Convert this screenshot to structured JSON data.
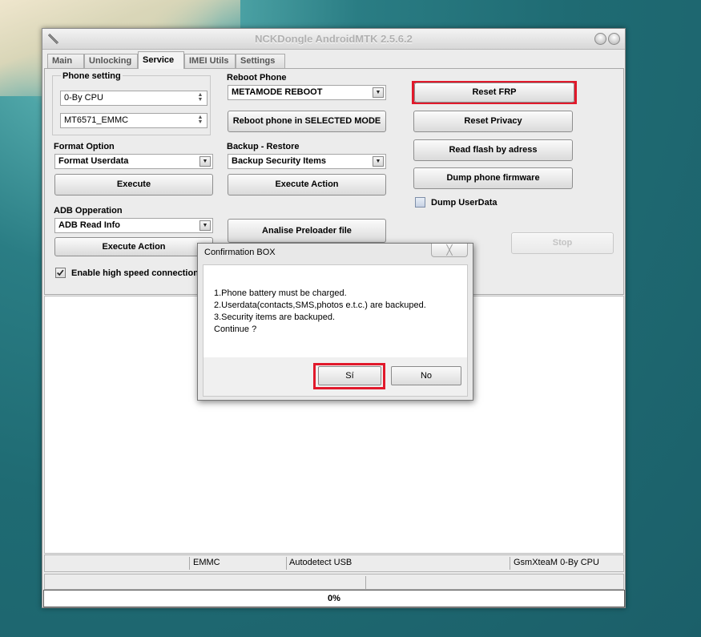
{
  "window": {
    "title": "NCKDongle AndroidMTK 2.5.6.2"
  },
  "tabs": [
    "Main",
    "Unlocking",
    "Service",
    "IMEI Utils",
    "Settings"
  ],
  "phone_setting": {
    "label": "Phone setting",
    "cpu": "0-By CPU",
    "model": "MT6571_EMMC"
  },
  "format": {
    "label": "Format Option",
    "value": "Format Userdata",
    "button": "Execute"
  },
  "adb": {
    "label": "ADB Opperation",
    "value": "ADB Read Info",
    "button": "Execute Action"
  },
  "high_speed": {
    "label": "Enable high speed connection",
    "checked": true
  },
  "reboot": {
    "label": "Reboot Phone",
    "value": "METAMODE REBOOT",
    "button": "Reboot phone in SELECTED MODE"
  },
  "backup": {
    "label": "Backup - Restore",
    "value": "Backup Security Items",
    "button": "Execute Action"
  },
  "preloader": {
    "button": "Analise Preloader file"
  },
  "right": {
    "reset_frp": "Reset FRP",
    "reset_privacy": "Reset Privacy",
    "read_flash": "Read flash by adress",
    "dump_firmware": "Dump phone firmware",
    "dump_userdata": "Dump UserData",
    "stop": "Stop"
  },
  "status": {
    "storage": "EMMC",
    "connection": "Autodetect USB",
    "user": "GsmXteaM 0-By CPU"
  },
  "progress": {
    "label": "0%",
    "value": 0
  },
  "dialog": {
    "title": "Confirmation BOX",
    "close": "╳",
    "lines": [
      "1.Phone battery must be charged.",
      "2.Userdata(contacts,SMS,photos e.t.c.) are backuped.",
      "3.Security items are backuped.",
      "Continue ?"
    ],
    "yes": "Sí",
    "no": "No"
  },
  "colors": {
    "highlight": "#e1192b"
  }
}
